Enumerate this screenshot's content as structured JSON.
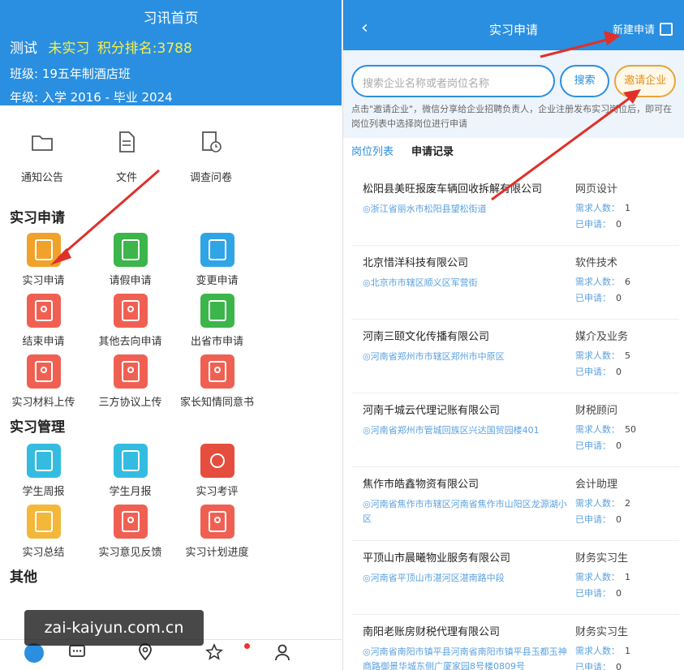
{
  "left": {
    "header": {
      "title": "习讯首页",
      "name": "测试",
      "status": "未实习",
      "rank": "积分排名:3788",
      "class": "班级: 19五年制酒店班",
      "grade": "年级: 入学 2016 - 毕业 2024"
    },
    "quick": [
      {
        "label": "通知公告",
        "icon": "folder-icon"
      },
      {
        "label": "文件",
        "icon": "document-icon"
      },
      {
        "label": "调查问卷",
        "icon": "survey-clock-icon"
      }
    ],
    "section_apply": {
      "title": "实习申请",
      "items": [
        {
          "label": "实习申请",
          "color": "#f0a22b",
          "icon": "notebook-icon"
        },
        {
          "label": "请假申请",
          "color": "#3cb54a",
          "icon": "calendar-add-icon"
        },
        {
          "label": "变更申请",
          "color": "#2fa5e6",
          "icon": "swap-icon"
        },
        {
          "label": "结束申请",
          "color": "#f06052",
          "icon": "certificate-icon"
        },
        {
          "label": "其他去向申请",
          "color": "#f06052",
          "icon": "certificate-icon"
        },
        {
          "label": "出省市申请",
          "color": "#3cb54a",
          "icon": "calendar-add-icon"
        },
        {
          "label": "实习材料上传",
          "color": "#f06052",
          "icon": "certificate-icon"
        },
        {
          "label": "三方协议上传",
          "color": "#f06052",
          "icon": "certificate-icon"
        },
        {
          "label": "家长知情同意书",
          "color": "#f06052",
          "icon": "certificate-icon"
        }
      ]
    },
    "section_manage": {
      "title": "实习管理",
      "items": [
        {
          "label": "学生周报",
          "color": "#33bce0",
          "icon": "weekly-report-icon"
        },
        {
          "label": "学生月报",
          "color": "#33bce0",
          "icon": "monthly-report-icon"
        },
        {
          "label": "实习考评",
          "color": "#e54d3e",
          "icon": "grade-icon"
        },
        {
          "label": "实习总结",
          "color": "#f3b83a",
          "icon": "summary-doc-icon"
        },
        {
          "label": "实习意见反馈",
          "color": "#f06052",
          "icon": "certificate-icon"
        },
        {
          "label": "实习计划进度",
          "color": "#f06052",
          "icon": "certificate-icon"
        }
      ]
    },
    "section_other": {
      "title": "其他"
    },
    "watermark": "zai-kaiyun.com.cn"
  },
  "right": {
    "header": {
      "title": "实习申请",
      "new_label": "新建申请"
    },
    "search": {
      "placeholder": "搜索企业名称或者岗位名称",
      "search_label": "搜索",
      "invite_label": "邀请企业"
    },
    "hint": "点击\"邀请企业\"，微信分享给企业招聘负责人，企业注册发布实习岗位后，即可在岗位列表中选择岗位进行申请",
    "tabs": {
      "positions": "岗位列表",
      "records": "申请记录"
    },
    "need_label": "需求人数：",
    "applied_label": "已申请：",
    "companies": [
      {
        "name": "松阳县美旺报废车辆回收拆解有限公司",
        "addr": "浙江省丽水市松阳县望松街道",
        "category": "网页设计",
        "need": "1",
        "applied": "0"
      },
      {
        "name": "北京惜洋科技有限公司",
        "addr": "北京市市辖区顺义区军营街",
        "category": "软件技术",
        "need": "6",
        "applied": "0"
      },
      {
        "name": "河南三颐文化传播有限公司",
        "addr": "河南省郑州市市辖区郑州市中原区",
        "category": "媒介及业务",
        "need": "5",
        "applied": "0"
      },
      {
        "name": "河南千城云代理记账有限公司",
        "addr": "河南省郑州市管城回族区兴达国贸园楼401",
        "category": "财税顾问",
        "need": "50",
        "applied": "0"
      },
      {
        "name": "焦作市皓鑫物资有限公司",
        "addr": "河南省焦作市市辖区河南省焦作市山阳区龙源湖小区",
        "category": "会计助理",
        "need": "2",
        "applied": "0"
      },
      {
        "name": "平顶山市晨曦物业服务有限公司",
        "addr": "河南省平顶山市湛河区湛南路中段",
        "category": "财务实习生",
        "need": "1",
        "applied": "0"
      },
      {
        "name": "南阳老账房财税代理有限公司",
        "addr": "河南省南阳市镇平县河南省南阳市镇平县玉都玉神商路御景华城东侧广厦家园8号楼0809号",
        "category": "财务实习生",
        "need": "1",
        "applied": "0"
      }
    ]
  }
}
